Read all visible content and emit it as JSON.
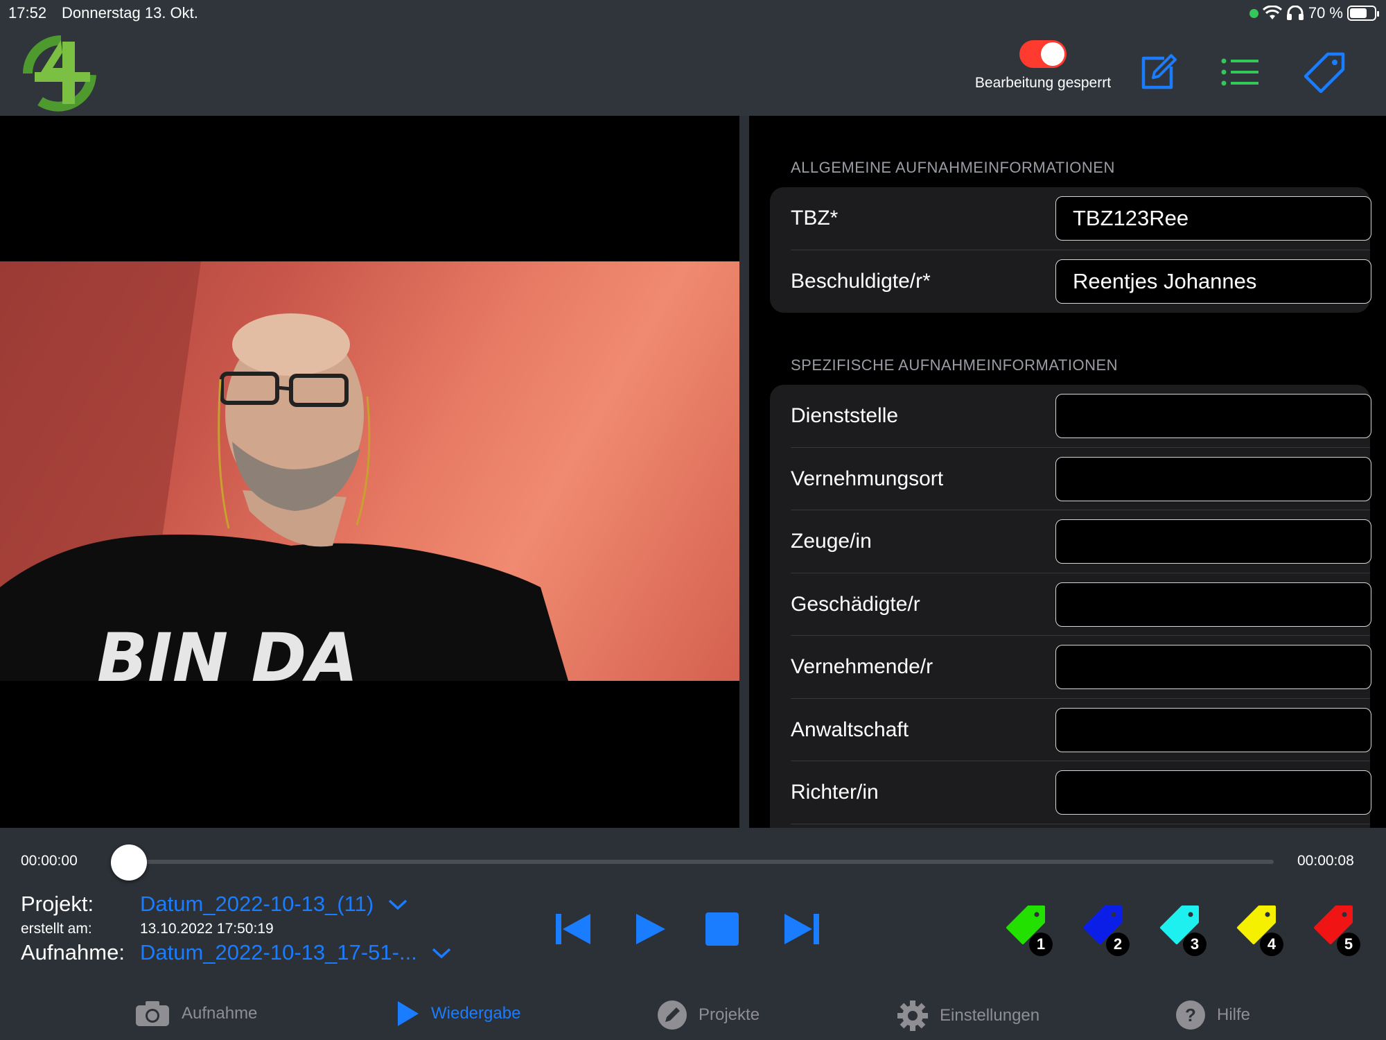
{
  "status_bar": {
    "time": "17:52",
    "date": "Donnerstag 13. Okt.",
    "battery": "70 %",
    "battery_level": 0.7
  },
  "header": {
    "lock_toggle_label": "Bearbeitung gesperrt",
    "lock_toggle_on": true
  },
  "video": {
    "shirt_text": "BIN DA"
  },
  "form": {
    "general_title": "ALLGEMEINE AUFNAHMEINFORMATIONEN",
    "general_rows": [
      {
        "label": "TBZ*",
        "value": "TBZ123Ree"
      },
      {
        "label": "Beschuldigte/r*",
        "value": "Reentjes Johannes"
      }
    ],
    "specific_title": "SPEZIFISCHE AUFNAHMEINFORMATIONEN",
    "specific_rows": [
      {
        "label": "Dienststelle",
        "value": ""
      },
      {
        "label": "Vernehmungsort",
        "value": ""
      },
      {
        "label": "Zeuge/in",
        "value": ""
      },
      {
        "label": "Geschädigte/r",
        "value": ""
      },
      {
        "label": "Vernehmende/r",
        "value": ""
      },
      {
        "label": "Anwaltschaft",
        "value": ""
      },
      {
        "label": "Richter/in",
        "value": ""
      }
    ]
  },
  "player": {
    "time_start": "00:00:00",
    "time_end": "00:00:08",
    "progress": 0.0,
    "projekt_label": "Projekt:",
    "projekt_value": "Datum_2022-10-13_(11)",
    "erstellt_label": "erstellt am:",
    "erstellt_value": "13.10.2022 17:50:19",
    "aufnahme_label": "Aufnahme:",
    "aufnahme_value": "Datum_2022-10-13_17-51-..."
  },
  "tags": [
    {
      "number": "1",
      "color": "#22e000"
    },
    {
      "number": "2",
      "color": "#0a1ee8"
    },
    {
      "number": "3",
      "color": "#1ef0f0"
    },
    {
      "number": "4",
      "color": "#f5f000"
    },
    {
      "number": "5",
      "color": "#f01414"
    }
  ],
  "tabs": [
    {
      "label": "Aufnahme",
      "icon": "camera-icon",
      "active": false
    },
    {
      "label": "Wiedergabe",
      "icon": "play-icon",
      "active": true
    },
    {
      "label": "Projekte",
      "icon": "pencil-icon",
      "active": false
    },
    {
      "label": "Einstellungen",
      "icon": "gear-icon",
      "active": false
    },
    {
      "label": "Hilfe",
      "icon": "help-icon",
      "active": false
    }
  ],
  "colors": {
    "accent_blue": "#1a7cff",
    "toggle_red": "#ff3b30",
    "list_green": "#34c759",
    "logo_green": "#4e9a2e"
  }
}
